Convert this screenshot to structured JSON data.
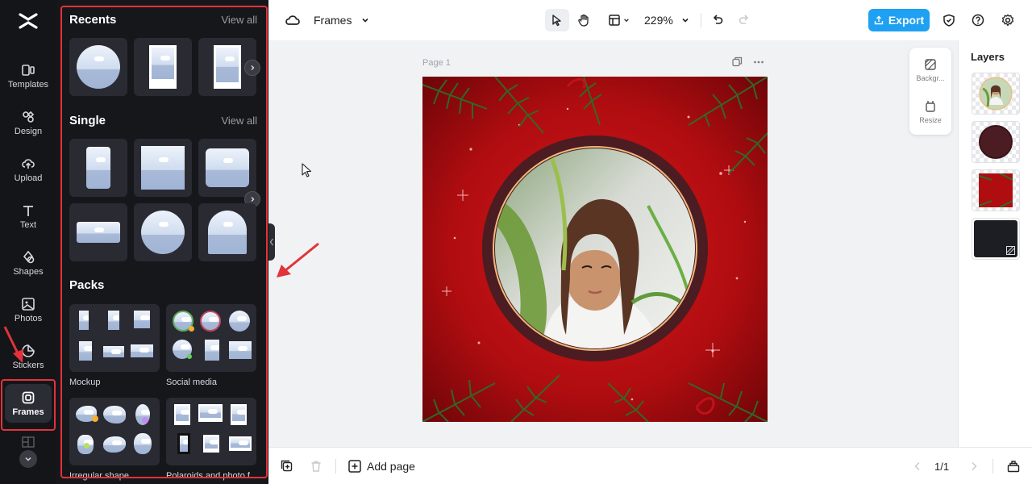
{
  "rail": {
    "items": [
      {
        "label": "Templates",
        "icon": "templates-icon"
      },
      {
        "label": "Design",
        "icon": "design-icon"
      },
      {
        "label": "Upload",
        "icon": "upload-icon"
      },
      {
        "label": "Text",
        "icon": "text-icon"
      },
      {
        "label": "Shapes",
        "icon": "shapes-icon"
      },
      {
        "label": "Photos",
        "icon": "photos-icon"
      },
      {
        "label": "Stickers",
        "icon": "stickers-icon"
      },
      {
        "label": "Frames",
        "icon": "frames-icon"
      }
    ],
    "active": "Frames"
  },
  "panel": {
    "recents": {
      "title": "Recents",
      "view_all": "View all"
    },
    "single": {
      "title": "Single",
      "view_all": "View all"
    },
    "packs": {
      "title": "Packs",
      "items": [
        {
          "label": "Mockup"
        },
        {
          "label": "Social media"
        },
        {
          "label": "Irregular shape"
        },
        {
          "label": "Polaroids and photo f"
        }
      ]
    }
  },
  "topbar": {
    "project_name": "Frames",
    "zoom": "229%",
    "export_label": "Export"
  },
  "canvas": {
    "page_label": "Page 1"
  },
  "side_tools": {
    "background_label": "Backgr...",
    "resize_label": "Resize"
  },
  "layers": {
    "title": "Layers"
  },
  "bottombar": {
    "add_page_label": "Add page",
    "page_counter": "1/1"
  },
  "colors": {
    "accent": "#1ea0f3",
    "highlight": "#e2333a",
    "rail_bg": "#141519",
    "panel_bg": "#16171b",
    "christmas_red": "#b00d10",
    "frame_ring": "#4b1c22"
  }
}
